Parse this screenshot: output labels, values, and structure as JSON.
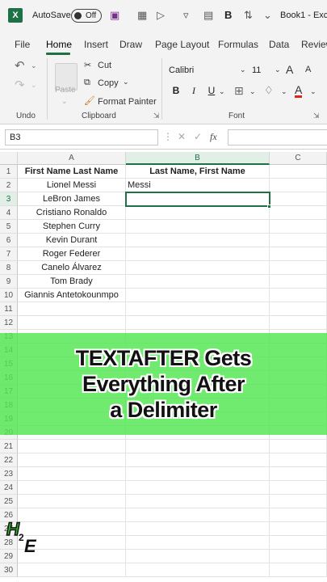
{
  "titlebar": {
    "app_logo": "X",
    "autosave_label": "AutoSave",
    "toggle_state": "Off",
    "bold_glyph": "B",
    "doc_title": "Book1 - Exc"
  },
  "tabs": [
    "File",
    "Home",
    "Insert",
    "Draw",
    "Page Layout",
    "Formulas",
    "Data",
    "Review"
  ],
  "ribbon": {
    "paste": "Paste",
    "cut": "Cut",
    "copy": "Copy",
    "format_painter": "Format Painter",
    "font_name": "Calibri",
    "font_size": "11",
    "grow": "A",
    "shrink": "A",
    "bold": "B",
    "italic": "I",
    "underline": "U",
    "font_color_glyph": "A",
    "groups": {
      "undo": "Undo",
      "clipboard": "Clipboard",
      "font": "Font"
    }
  },
  "formula_bar": {
    "name_box": "B3",
    "fx": "fx",
    "value": ""
  },
  "columns": [
    "A",
    "B",
    "C"
  ],
  "rows": [
    {
      "n": "1",
      "a": "First Name Last Name",
      "b": "Last Name, First Name"
    },
    {
      "n": "2",
      "a": "Lionel Messi",
      "b": "Messi"
    },
    {
      "n": "3",
      "a": "LeBron James",
      "b": ""
    },
    {
      "n": "4",
      "a": "Cristiano Ronaldo",
      "b": ""
    },
    {
      "n": "5",
      "a": "Stephen Curry",
      "b": ""
    },
    {
      "n": "6",
      "a": "Kevin Durant",
      "b": ""
    },
    {
      "n": "7",
      "a": "Roger Federer",
      "b": ""
    },
    {
      "n": "8",
      "a": "Canelo Álvarez",
      "b": ""
    },
    {
      "n": "9",
      "a": "Tom Brady",
      "b": ""
    },
    {
      "n": "10",
      "a": "Giannis Antetokounmpo",
      "b": ""
    },
    {
      "n": "11",
      "a": "",
      "b": ""
    },
    {
      "n": "12",
      "a": "",
      "b": ""
    },
    {
      "n": "13",
      "a": "",
      "b": ""
    },
    {
      "n": "14",
      "a": "",
      "b": ""
    },
    {
      "n": "15",
      "a": "",
      "b": ""
    },
    {
      "n": "16",
      "a": "",
      "b": ""
    },
    {
      "n": "17",
      "a": "",
      "b": ""
    },
    {
      "n": "18",
      "a": "",
      "b": ""
    },
    {
      "n": "19",
      "a": "",
      "b": ""
    },
    {
      "n": "20",
      "a": "",
      "b": ""
    },
    {
      "n": "21",
      "a": "",
      "b": ""
    },
    {
      "n": "22",
      "a": "",
      "b": ""
    },
    {
      "n": "23",
      "a": "",
      "b": ""
    },
    {
      "n": "24",
      "a": "",
      "b": ""
    },
    {
      "n": "25",
      "a": "",
      "b": ""
    },
    {
      "n": "26",
      "a": "",
      "b": ""
    },
    {
      "n": "27",
      "a": "",
      "b": ""
    },
    {
      "n": "28",
      "a": "",
      "b": ""
    },
    {
      "n": "29",
      "a": "",
      "b": ""
    },
    {
      "n": "30",
      "a": "",
      "b": ""
    }
  ],
  "banner": [
    "TEXTAFTER Gets",
    "Everything After",
    "a Delimiter"
  ],
  "logo": {
    "top": "H",
    "sub": "2",
    "bottom": "E"
  },
  "colors": {
    "accent": "#1e7145",
    "banner": "#55e655"
  }
}
